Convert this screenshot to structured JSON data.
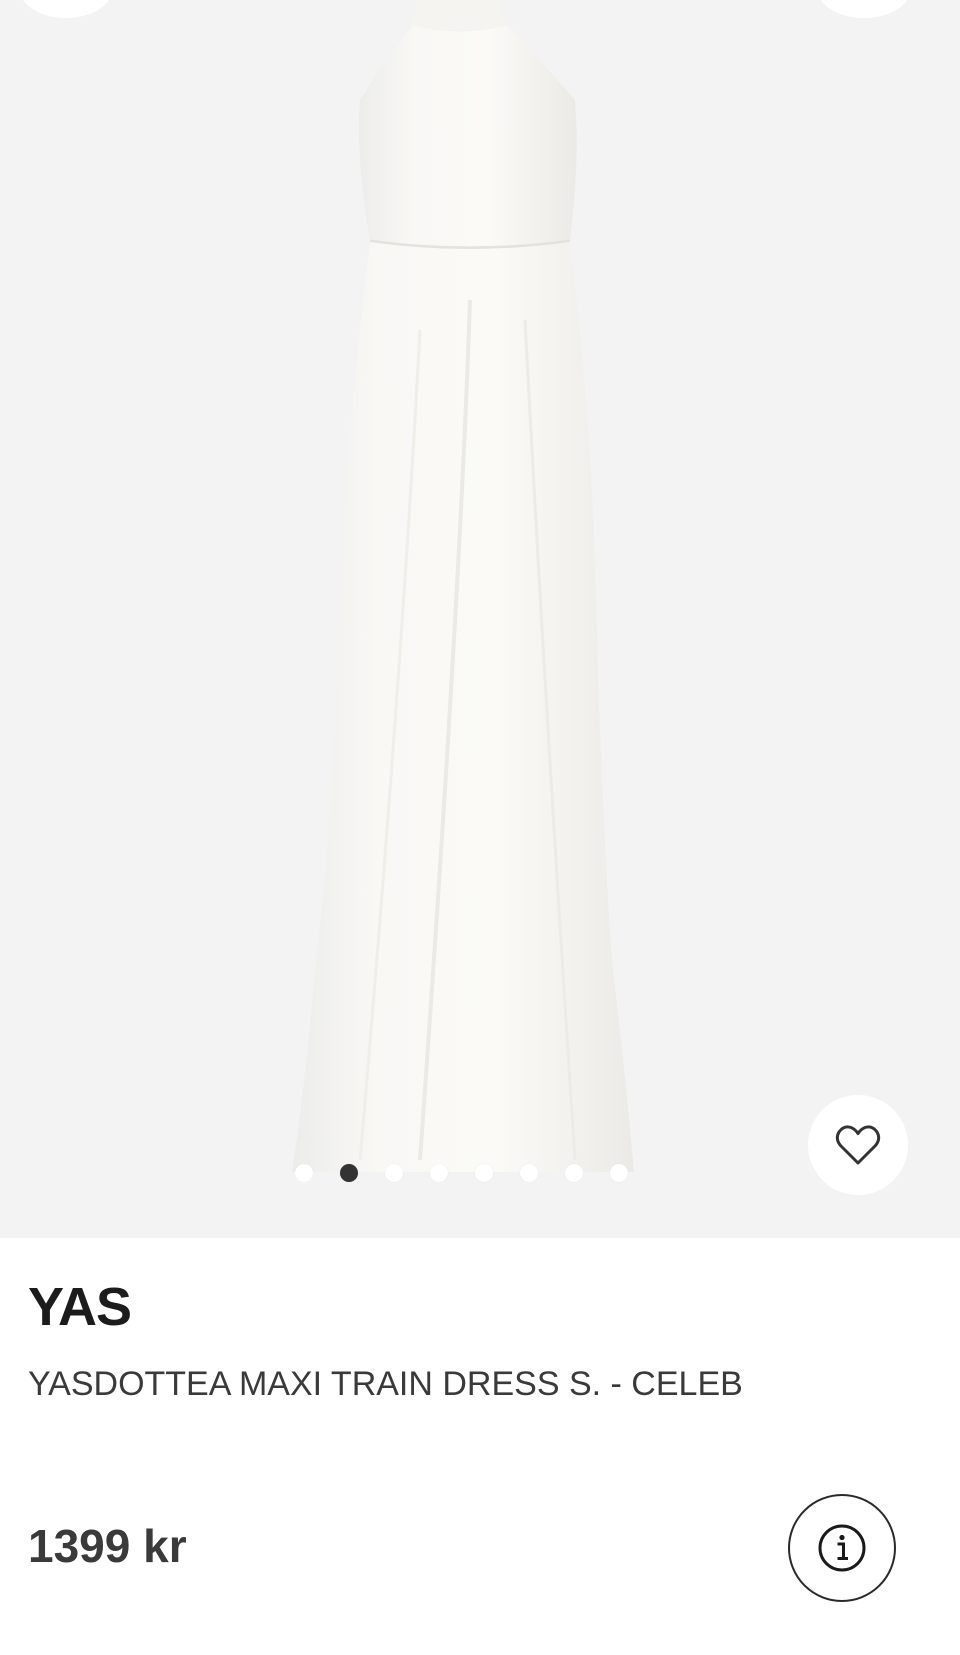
{
  "product": {
    "brand": "YAS",
    "name": "YASDOTTEA MAXI TRAIN DRESS S. - CELEB",
    "price": "1399 kr"
  },
  "gallery": {
    "image_count": 8,
    "active_index": 1
  },
  "icons": {
    "favorite": "heart-outline-icon",
    "info": "info-circle-icon"
  },
  "colors": {
    "image_background": "#f3f3f3",
    "dress": "#f8f7f3",
    "active_dot": "#333333",
    "text": "#1f1f1f"
  }
}
